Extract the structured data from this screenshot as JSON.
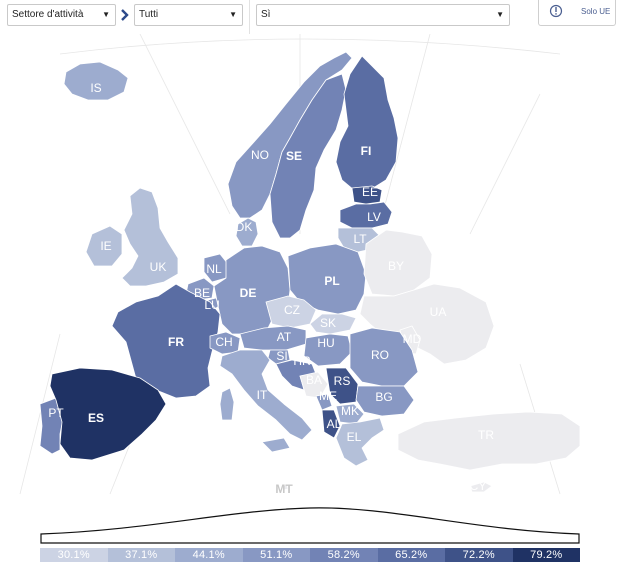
{
  "filters": {
    "sector": {
      "value": "Settore d'attività"
    },
    "subsector": {
      "value": "Tutti"
    },
    "answer": {
      "value": "Sì"
    },
    "eu_only": {
      "label": "Solo UE",
      "icon": "info-circle-icon"
    }
  },
  "map": {
    "countries": [
      {
        "code": "IS",
        "label": "IS"
      },
      {
        "code": "NO",
        "label": "NO"
      },
      {
        "code": "SE",
        "label": "SE"
      },
      {
        "code": "FI",
        "label": "FI"
      },
      {
        "code": "EE",
        "label": "EE"
      },
      {
        "code": "LV",
        "label": "LV"
      },
      {
        "code": "LT",
        "label": "LT"
      },
      {
        "code": "DK",
        "label": "DK"
      },
      {
        "code": "IE",
        "label": "IE"
      },
      {
        "code": "UK",
        "label": "UK"
      },
      {
        "code": "NL",
        "label": "NL"
      },
      {
        "code": "BE",
        "label": "BE"
      },
      {
        "code": "LU",
        "label": "LU"
      },
      {
        "code": "DE",
        "label": "DE"
      },
      {
        "code": "PL",
        "label": "PL"
      },
      {
        "code": "BY",
        "label": "BY"
      },
      {
        "code": "UA",
        "label": "UA"
      },
      {
        "code": "CZ",
        "label": "CZ"
      },
      {
        "code": "SK",
        "label": "SK"
      },
      {
        "code": "FR",
        "label": "FR"
      },
      {
        "code": "CH",
        "label": "CH"
      },
      {
        "code": "AT",
        "label": "AT"
      },
      {
        "code": "HU",
        "label": "HU"
      },
      {
        "code": "MD",
        "label": "MD"
      },
      {
        "code": "RO",
        "label": "RO"
      },
      {
        "code": "SI",
        "label": "SI"
      },
      {
        "code": "HR",
        "label": "HR"
      },
      {
        "code": "BA",
        "label": "BA"
      },
      {
        "code": "RS",
        "label": "RS"
      },
      {
        "code": "ME",
        "label": "ME"
      },
      {
        "code": "BG",
        "label": "BG"
      },
      {
        "code": "MK",
        "label": "MK"
      },
      {
        "code": "AL",
        "label": "AL"
      },
      {
        "code": "EL",
        "label": "EL"
      },
      {
        "code": "IT",
        "label": "IT"
      },
      {
        "code": "PT",
        "label": "PT"
      },
      {
        "code": "ES",
        "label": "ES"
      },
      {
        "code": "TR",
        "label": "TR"
      },
      {
        "code": "MT",
        "label": "MT"
      },
      {
        "code": "CY",
        "label": "CY"
      }
    ],
    "scale_colors": [
      "#ccd3e4",
      "#b4c0d9",
      "#9daccf",
      "#8898c3",
      "#7283b5",
      "#5a6da3",
      "#3e5288",
      "#1f3264"
    ],
    "no_data_color": "#ececef"
  },
  "legend": {
    "ticks": [
      "30.1%",
      "37.1%",
      "44.1%",
      "51.1%",
      "58.2%",
      "65.2%",
      "72.2%",
      "79.2%"
    ]
  }
}
